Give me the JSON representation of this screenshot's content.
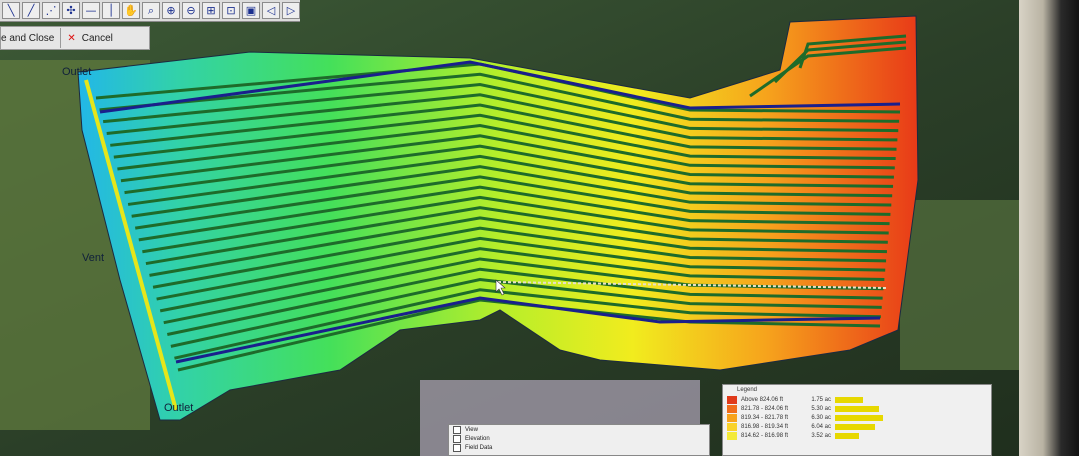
{
  "toolbar": {
    "icons": [
      "line-icon",
      "diagonal-icon",
      "connect-icon",
      "move-icon",
      "horizontal-line-icon",
      "vertical-line-icon",
      "pan-hand-icon",
      "magnify-icon",
      "zoom-in-icon",
      "zoom-out-icon",
      "zoom-extent-icon",
      "zoom-box-icon",
      "zoom-window-icon",
      "zoom-prev-icon",
      "zoom-next-icon"
    ]
  },
  "actions": {
    "save_close": "e and Close",
    "cancel": "Cancel"
  },
  "map": {
    "outlet_top": "Outlet",
    "outlet_bottom": "Outlet",
    "vent": "Vent"
  },
  "legend": {
    "title": "Legend",
    "rows": [
      {
        "range": "Above 824.06 ft",
        "acres": "1.75 ac",
        "color": "#e03a1a",
        "bar": 0.35
      },
      {
        "range": "821.78 - 824.06 ft",
        "acres": "5.30 ac",
        "color": "#f06d1c",
        "bar": 0.55
      },
      {
        "range": "819.34 - 821.78 ft",
        "acres": "6.30 ac",
        "color": "#f7a21c",
        "bar": 0.6
      },
      {
        "range": "816.98 - 819.34 ft",
        "acres": "6.04 ac",
        "color": "#f9d22a",
        "bar": 0.5
      },
      {
        "range": "814.62 - 816.98 ft",
        "acres": "3.52 ac",
        "color": "#f3ea38",
        "bar": 0.3
      }
    ]
  },
  "layers": {
    "items": [
      "View",
      "Elevation",
      "Field Data"
    ]
  },
  "colors": {
    "main_line": "#1a1f8c",
    "lateral": "#1e6b2a",
    "edge_line": "#e6e61a",
    "panel": "#e6e6e6"
  }
}
